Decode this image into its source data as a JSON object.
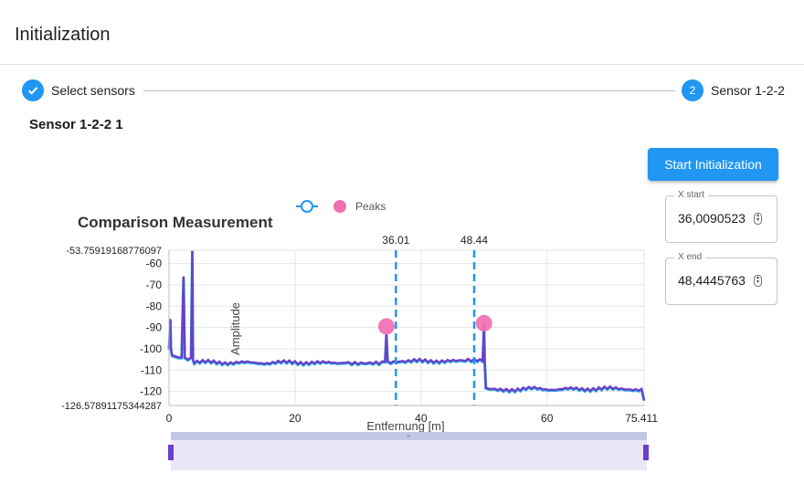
{
  "app": {
    "title": "Initialization"
  },
  "stepper": {
    "steps": [
      {
        "label": "Select sensors",
        "state": "completed",
        "icon": "check-icon"
      },
      {
        "number": "2",
        "label": "Sensor 1-2-2",
        "state": "active"
      }
    ]
  },
  "sensor": {
    "title": "Sensor 1-2-2 1"
  },
  "actions": {
    "start_label": "Start Initialization"
  },
  "fields": {
    "x_start": {
      "label": "X start",
      "value": "36,0090523"
    },
    "x_end": {
      "label": "X end",
      "value": "48,4445763"
    }
  },
  "colors": {
    "accent": "#2196f3",
    "series": "#6a3fc9",
    "series_under": "#29a3e0",
    "peaks": "#f06fb2",
    "marker_line": "#2196f3"
  },
  "chart_data": {
    "type": "line",
    "title": "Comparison Measurement",
    "xlabel": "Entfernung [m]",
    "ylabel": "Amplitude",
    "xlim": [
      0,
      75.4111
    ],
    "ylim": [
      -126.57891175344287,
      -53.75919168776097
    ],
    "y_min_label": "-126.57891175344287",
    "y_max_label": "-53.75919168776097",
    "x_ticks": [
      "0",
      "20",
      "40",
      "60",
      "75.4111"
    ],
    "y_ticks": [
      "-60",
      "-70",
      "-80",
      "-90",
      "-100",
      "-110",
      "-120"
    ],
    "grid": true,
    "legend": {
      "position": "top",
      "entries": [
        "",
        "Peaks"
      ]
    },
    "markers": [
      {
        "x": 36.01,
        "label": "36.01"
      },
      {
        "x": 48.44,
        "label": "48.44"
      }
    ],
    "series": [
      {
        "x": [
          0,
          0.2,
          0.3,
          0.5,
          1.0,
          1.5,
          2.0,
          2.3,
          2.5,
          3.0,
          3.5,
          3.7,
          3.8,
          4.0,
          8,
          12,
          16,
          20,
          24,
          28,
          30,
          34.3,
          34.5,
          34.7,
          38,
          42,
          46,
          48,
          49.8,
          50.0,
          50.1,
          50.3,
          54,
          58,
          62,
          66,
          70,
          75.0,
          75.4111
        ],
        "y": [
          -100,
          -86,
          -100,
          -103,
          -103.5,
          -104,
          -104,
          -66,
          -104,
          -105,
          -104,
          -54,
          -105,
          -106,
          -106.3,
          -106.5,
          -106.4,
          -106.2,
          -106.6,
          -106.1,
          -106.3,
          -106.0,
          -93,
          -106,
          -105.8,
          -105.5,
          -105.9,
          -105.6,
          -105.7,
          -88,
          -105.5,
          -118.8,
          -119.0,
          -118.6,
          -118.9,
          -118.7,
          -118.6,
          -118.8,
          -124
        ]
      }
    ],
    "peaks": {
      "x": [
        34.5,
        50.0
      ],
      "y": [
        -89.5,
        -88
      ]
    },
    "zoom_range": [
      0,
      75.4111
    ]
  }
}
